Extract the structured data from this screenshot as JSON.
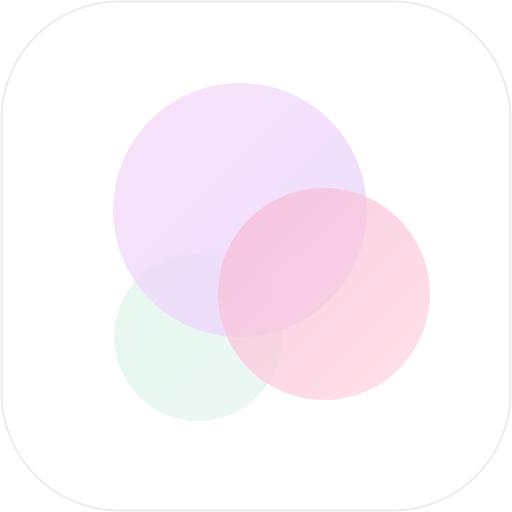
{
  "icon": {
    "semantic": "overlapping-circles-app-icon",
    "tile_color": "#ffffff",
    "tile_border_color": "#ececec",
    "circles": [
      {
        "name": "mint",
        "gradient": [
          "#e6f7ef",
          "#eaf6f2"
        ],
        "opacity": 0.95
      },
      {
        "name": "lavender",
        "gradient": [
          "#f8ddf7",
          "#e6d6ff"
        ],
        "opacity": 0.82
      },
      {
        "name": "pink",
        "gradient": [
          "#f6b8d4",
          "#ffd7e1"
        ],
        "opacity": 0.72
      }
    ]
  }
}
